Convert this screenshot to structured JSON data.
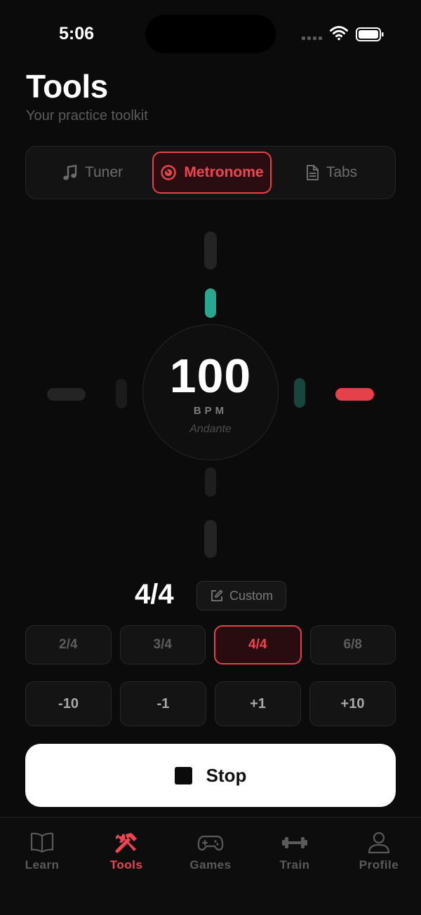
{
  "status_bar": {
    "time": "5:06"
  },
  "header": {
    "title": "Tools",
    "subtitle": "Your practice toolkit"
  },
  "tabs": [
    {
      "label": "Tuner",
      "icon": "music-note-icon",
      "active": false
    },
    {
      "label": "Metronome",
      "icon": "metronome-icon",
      "active": true
    },
    {
      "label": "Tabs",
      "icon": "document-icon",
      "active": false
    }
  ],
  "metronome": {
    "bpm": "100",
    "bpm_label": "BPM",
    "tempo_name": "Andante",
    "time_signature": "4/4",
    "custom_label": "Custom",
    "time_signatures": [
      "2/4",
      "3/4",
      "4/4",
      "6/8"
    ],
    "selected_time_signature": "4/4",
    "adjustments": [
      "-10",
      "-1",
      "+1",
      "+10"
    ],
    "action_label": "Stop"
  },
  "colors": {
    "accent": "#e5414b",
    "active_beat": "#2aa58f",
    "dim_beat": "#17463f",
    "background": "#0b0b0b"
  },
  "bottom_nav": [
    {
      "label": "Learn",
      "icon": "book-icon",
      "active": false
    },
    {
      "label": "Tools",
      "icon": "tools-icon",
      "active": true
    },
    {
      "label": "Games",
      "icon": "gamepad-icon",
      "active": false
    },
    {
      "label": "Train",
      "icon": "dumbbell-icon",
      "active": false
    },
    {
      "label": "Profile",
      "icon": "person-icon",
      "active": false
    }
  ]
}
